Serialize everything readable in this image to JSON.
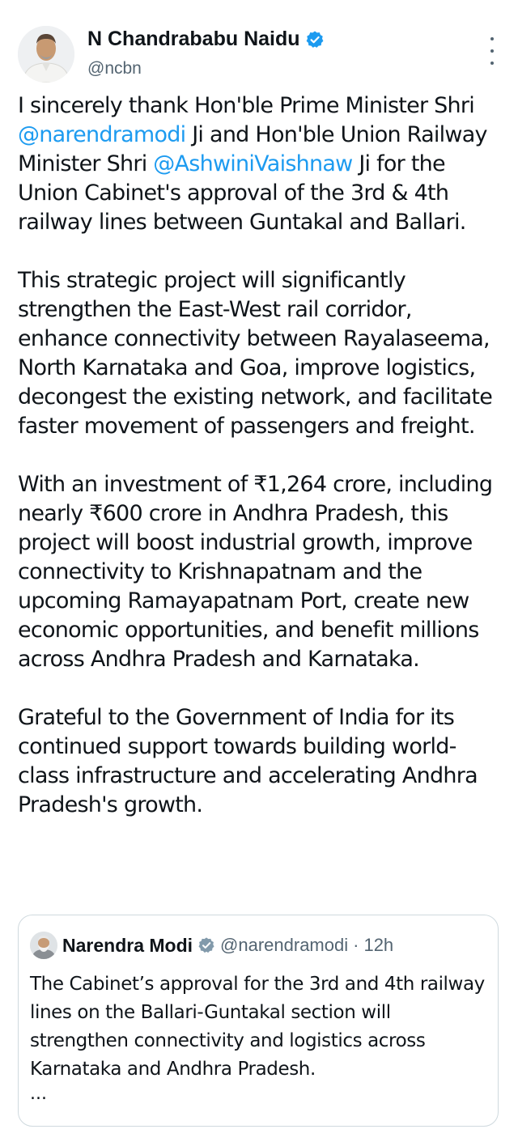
{
  "author": {
    "display_name": "N Chandrababu Naidu",
    "handle": "@ncbn",
    "verified": true,
    "avatar_icon": "user-avatar-icon"
  },
  "tweet": {
    "paragraphs": [
      {
        "segments": [
          {
            "text": "I sincerely thank Hon'ble Prime Minister Shri ",
            "mention": false
          },
          {
            "text": "@narendramodi",
            "mention": true
          },
          {
            "text": " Ji and Hon'ble Union Railway Minister Shri ",
            "mention": false
          },
          {
            "text": "@AshwiniVaishnaw",
            "mention": true
          },
          {
            "text": " Ji for the Union Cabinet's approval of the 3rd & 4th railway lines between Guntakal and Ballari.",
            "mention": false
          }
        ]
      },
      {
        "segments": [
          {
            "text": "This strategic project will significantly strengthen the East-West rail corridor, enhance connectivity between Rayalaseema, North Karnataka and Goa, improve logistics, decongest the existing network, and facilitate faster movement of passengers and freight.",
            "mention": false
          }
        ]
      },
      {
        "segments": [
          {
            "text": "With an investment of ₹1,264 crore, including nearly ₹600 crore in Andhra Pradesh, this project will boost industrial growth, improve connectivity to Krishnapatnam and the upcoming Ramayapatnam Port, create new economic opportunities, and benefit millions across Andhra Pradesh and Karnataka.",
            "mention": false
          }
        ]
      },
      {
        "segments": [
          {
            "text": "Grateful to the Government of India for its continued support towards building world-class infrastructure and accelerating Andhra Pradesh's growth.",
            "mention": false
          }
        ]
      }
    ]
  },
  "quoted_tweet": {
    "display_name": "Narendra Modi",
    "handle": "@narendramodi",
    "separator": "·",
    "time": "12h",
    "verified": true,
    "text": "The Cabinet’s approval for the 3rd and 4th railway lines on the Ballari-Guntakal section will strengthen connectivity and logistics across Karnataka and Andhra Pradesh.",
    "truncation": "..."
  },
  "icons": {
    "verified": "verified-badge-icon",
    "more": "more-options-icon"
  },
  "colors": {
    "accent": "#1d9bf0",
    "text": "#0f1419",
    "secondary": "#536471",
    "border": "#cfd9de"
  }
}
